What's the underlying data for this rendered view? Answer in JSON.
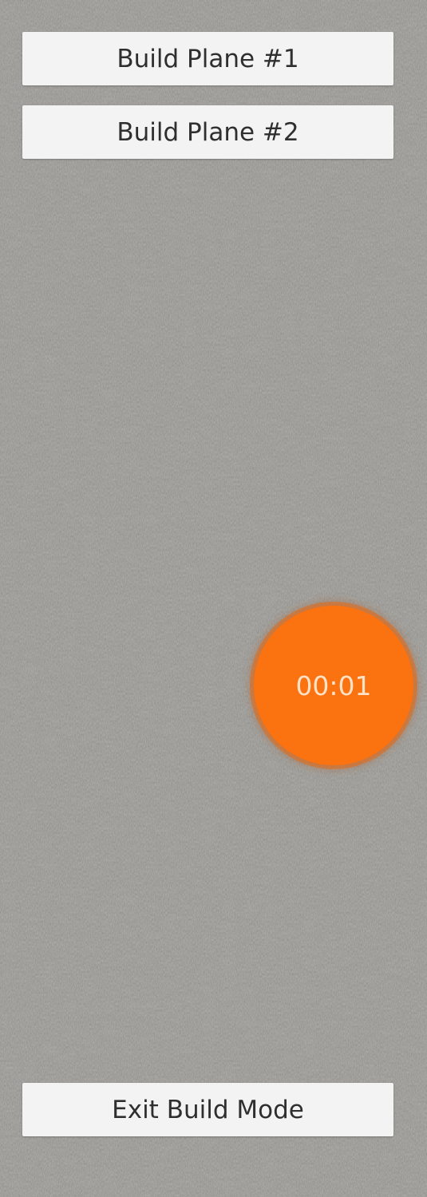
{
  "buttons": {
    "build_plane_1": "Build Plane #1",
    "build_plane_2": "Build Plane #2",
    "exit_build_mode": "Exit Build Mode"
  },
  "timer": {
    "value": "00:01",
    "color": "#fb7210"
  },
  "background": {
    "base_color": "#8f8e8a"
  }
}
